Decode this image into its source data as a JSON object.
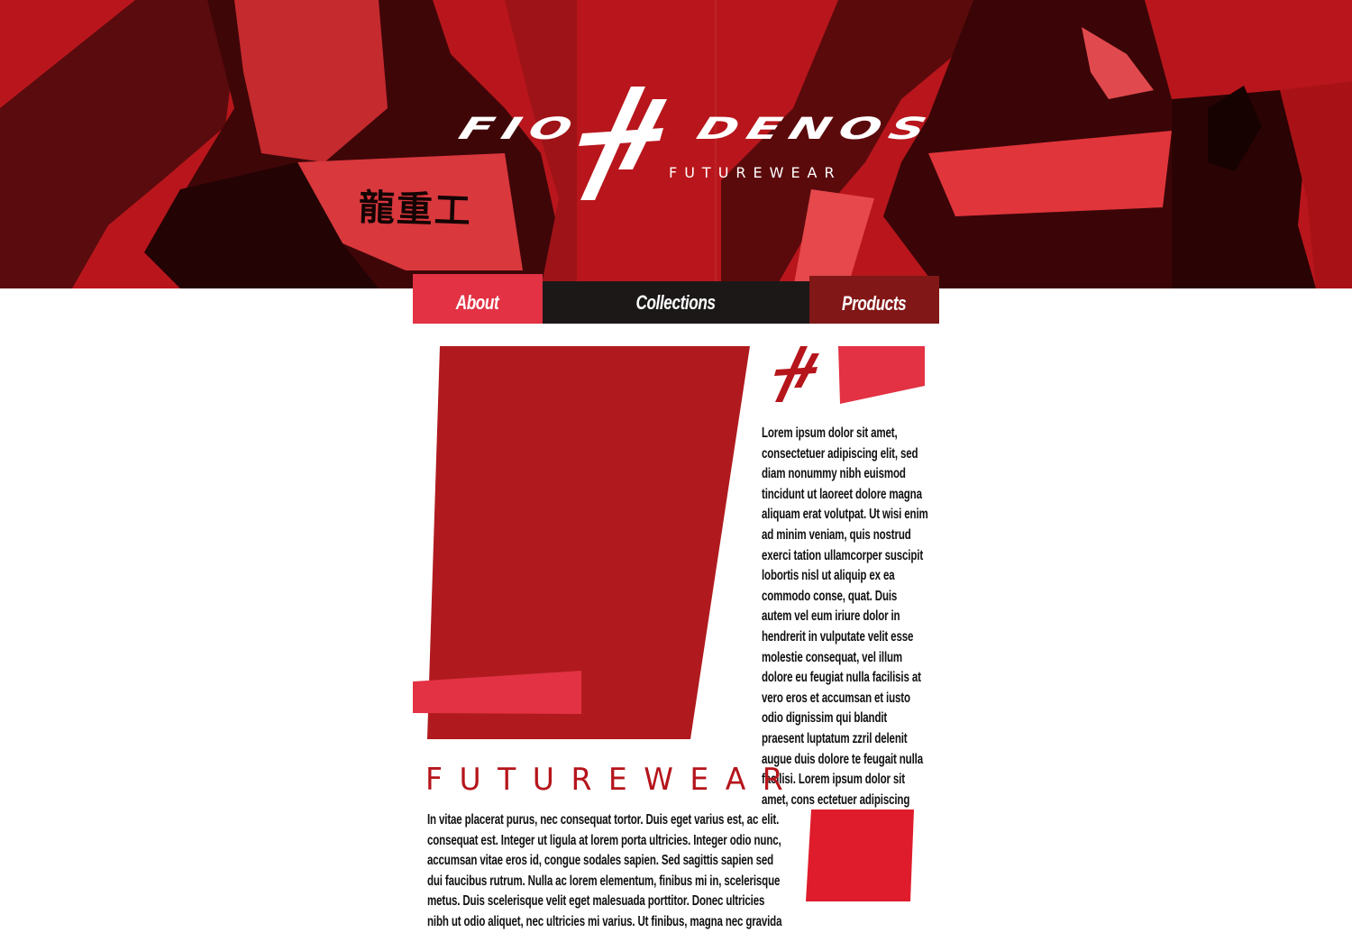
{
  "brand": {
    "word_left": "FIO",
    "word_right": "DENOS",
    "tagline": "FUTUREWEAR",
    "hero_kanji": "龍重工"
  },
  "nav": {
    "about": "About",
    "collections": "Collections",
    "products": "Products"
  },
  "content": {
    "intro_paragraph": "Lorem ipsum dolor sit amet, consectetuer adipiscing elit, sed diam nonummy nibh euismod tincidunt ut laoreet dolore magna aliquam erat volutpat. Ut wisi enim ad minim veniam, quis nostrud exerci tation ullamcorper suscipit lobortis nisl ut aliquip ex ea commodo conse, quat. Duis autem vel eum iriure dolor in hendrerit in vulputate velit esse molestie consequat, vel illum dolore eu feugiat nulla facilisis at vero eros et accumsan et iusto odio dignissim qui blandit praesent luptatum zzril delenit augue duis dolore te feugait nulla facilisi. Lorem ipsum dolor sit amet, cons ectetuer adipiscing elit.",
    "section_heading": "FUTUREWEAR",
    "section_paragraph": "In vitae placerat purus, nec consequat tortor. Duis eget varius est, ac consequat est. Integer ut ligula at lorem porta ultricies. Integer odio nunc, accumsan vitae eros id, congue sodales sapien. Sed sagittis sapien sed dui faucibus rutrum. Nulla ac lorem elementum, finibus mi in, scelerisque metus. Duis scelerisque velit eget malesuada porttitor. Donec ultricies nibh ut odio aliquet, nec ultricies mi varius. Ut finibus, magna nec gravida"
  },
  "colors": {
    "hero_red": "#b5151b",
    "accent_pink_red": "#e23244",
    "dark": "#1c1818",
    "maroon": "#821717",
    "panel_red": "#b01a1e"
  },
  "icons": {
    "logo_mark": "slashed-h-logo-mark",
    "small_mark": "slashed-h-logo-mark"
  }
}
